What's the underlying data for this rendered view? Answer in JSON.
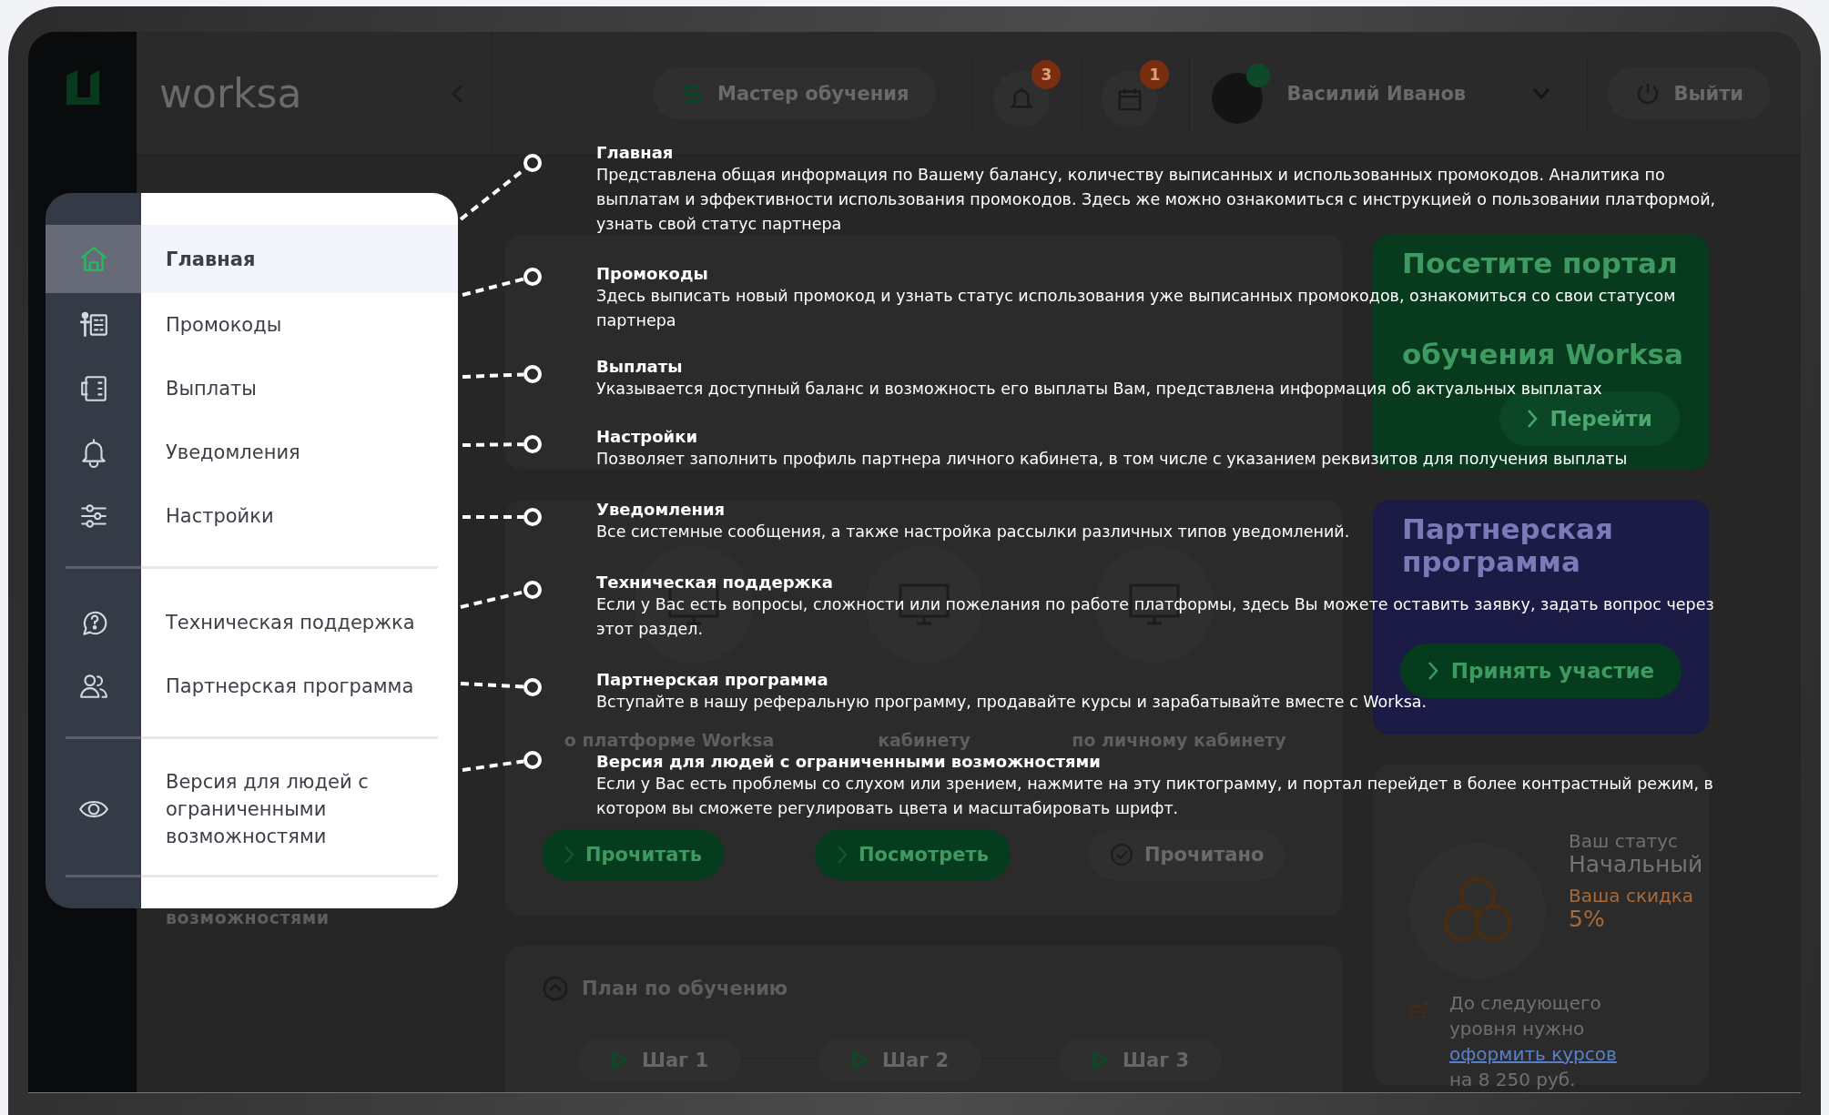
{
  "header": {
    "logo_text": "worksa",
    "tutorial_button": "Мастер обучения",
    "notifications_badge": "3",
    "calendar_badge": "1",
    "user_name": "Василий Иванов",
    "logout_button": "Выйти"
  },
  "background_menu": {
    "text": "возможностями"
  },
  "info_card": {
    "captions": [
      "о платформе Worksa",
      "кабинету",
      "по личному кабинету"
    ],
    "buttons": [
      {
        "label": "Прочитать",
        "kind": "primary"
      },
      {
        "label": "Посмотреть",
        "kind": "primary"
      },
      {
        "label": "Прочитано",
        "kind": "done"
      }
    ]
  },
  "training_plan": {
    "title": "План по обучению",
    "steps": [
      "Шаг 1",
      "Шаг 2",
      "Шаг 3"
    ]
  },
  "promo_cards": [
    {
      "kind": "portal",
      "title": "Посетите портал",
      "title_bottom": "обучения Worksa",
      "button": "Перейти"
    },
    {
      "kind": "partner",
      "title": "Партнерская программа",
      "button": "Принять участие"
    }
  ],
  "status_card": {
    "status_label": "Ваш статус",
    "status": "Начальный",
    "discount_label": "Ваша скидка",
    "discount": "5%",
    "next_level_text": "До следующего уровня нужно",
    "next_level_link": "оформить курсов",
    "next_level_amount": "на 8 250 руб."
  },
  "menu": {
    "groups": [
      [
        {
          "label": "Главная",
          "selected": true
        },
        {
          "label": "Промокоды",
          "selected": false
        },
        {
          "label": "Выплаты",
          "selected": false
        },
        {
          "label": "Уведомления",
          "selected": false
        },
        {
          "label": "Настройки",
          "selected": false
        }
      ],
      [
        {
          "label": "Техническая поддержка",
          "selected": false
        },
        {
          "label": "Партнерская программа",
          "selected": false
        }
      ],
      [
        {
          "label": "Версия для людей с ограниченными возможностями",
          "selected": false
        }
      ]
    ]
  },
  "annotations": [
    {
      "title": "Главная",
      "text": "Представлена общая информация по Вашему балансу, количеству выписанных и использованных промокодов. Аналитика по выплатам и эффективности использования промокодов. Здесь же можно ознакомиться с инструкцией о пользовании платформой, узнать свой статус партнера"
    },
    {
      "title": "Промокоды",
      "text": "Здесь выписать новый промокод и узнать статус использования уже выписанных промокодов, ознакомиться со свои статусом партнера"
    },
    {
      "title": "Выплаты",
      "text": "Указывается доступный баланс и возможность его выплаты Вам, представлена информация об актуальных выплатах"
    },
    {
      "title": "Настройки",
      "text": "Позволяет заполнить профиль партнера личного кабинета, в том числе с указанием реквизитов для получения выплаты"
    },
    {
      "title": "Уведомления",
      "text": "Все системные сообщения, а также настройка рассылки различных типов уведомлений."
    },
    {
      "title": "Техническая поддержка",
      "text": "Если у Вас есть вопросы, сложности или пожелания по работе платформы, здесь Вы можете оставить заявку, задать вопрос через этот раздел."
    },
    {
      "title": "Партнерская программа",
      "text": "Вступайте в нашу реферальную программу, продавайте курсы и зарабатывайте вместе с Worksa."
    },
    {
      "title": "Версия для людей с ограниченными возможностями",
      "text": "Если у Вас есть проблемы со слухом или зрением, нажмите на эту пиктограмму, и портал перейдет в более контрастный режим, в котором вы сможете регулировать цвета и масштабировать шрифт."
    }
  ]
}
